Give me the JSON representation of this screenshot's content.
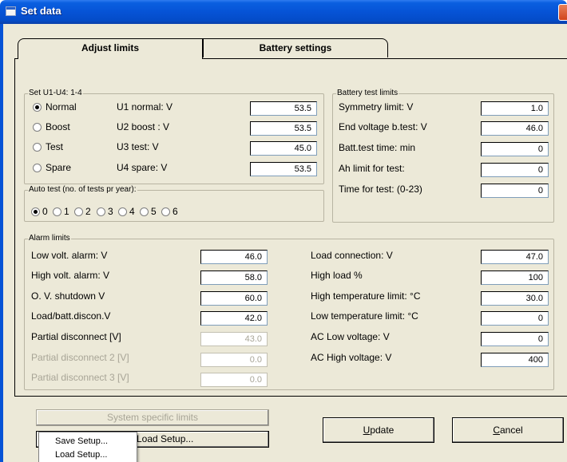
{
  "window": {
    "title": "Set data"
  },
  "tabs": [
    {
      "label": "Adjust limits",
      "active": true
    },
    {
      "label": "Battery settings",
      "active": false
    }
  ],
  "set_u": {
    "legend": "Set U1-U4: 1-4",
    "rows": [
      {
        "radio": "Normal",
        "label": "U1 normal:  V",
        "value": "53.5",
        "checked": true
      },
      {
        "radio": "Boost",
        "label": "U2 boost :  V",
        "value": "53.5",
        "checked": false
      },
      {
        "radio": "Test",
        "label": "U3 test:   V",
        "value": "45.0",
        "checked": false
      },
      {
        "radio": "Spare",
        "label": "U4 spare:   V",
        "value": "53.5",
        "checked": false
      }
    ]
  },
  "auto_test": {
    "legend": "Auto test (no. of tests pr year):",
    "options": [
      "0",
      "1",
      "2",
      "3",
      "4",
      "5",
      "6"
    ],
    "selected": "0"
  },
  "battery_test": {
    "legend": "Battery test limits",
    "rows": [
      {
        "label": "Symmetry limit: V",
        "value": "1.0"
      },
      {
        "label": "End voltage b.test: V",
        "value": "46.0"
      },
      {
        "label": "Batt.test time: min",
        "value": "0"
      },
      {
        "label": "Ah limit for test:",
        "value": "0"
      },
      {
        "label": "Time for test: (0-23)",
        "value": "0"
      }
    ]
  },
  "alarm_limits": {
    "legend": "Alarm limits",
    "left": [
      {
        "label": "Low volt. alarm: V",
        "value": "46.0",
        "disabled": false
      },
      {
        "label": "High volt. alarm: V",
        "value": "58.0",
        "disabled": false
      },
      {
        "label": "O. V. shutdown V",
        "value": "60.0",
        "disabled": false
      },
      {
        "label": "Load/batt.discon.V",
        "value": "42.0",
        "disabled": false
      },
      {
        "label": "Partial disconnect  [V]",
        "value": "43.0",
        "disabled": false,
        "value_disabled": true
      },
      {
        "label": "Partial disconnect 2 [V]",
        "value": "0.0",
        "disabled": true
      },
      {
        "label": "Partial disconnect 3 [V]",
        "value": "0.0",
        "disabled": true
      }
    ],
    "right": [
      {
        "label": "Load connection: V",
        "value": "47.0"
      },
      {
        "label": "High load %",
        "value": "100"
      },
      {
        "label": "High temperature limit: °C",
        "value": "30.0"
      },
      {
        "label": "Low temperature limit: °C",
        "value": "0"
      },
      {
        "label": "AC Low voltage: V",
        "value": "0"
      },
      {
        "label": "AC High voltage: V",
        "value": "400"
      }
    ]
  },
  "buttons": {
    "system_specific": "System specific limits",
    "load_setup": "Load Setup...",
    "update_first": "U",
    "update_rest": "pdate",
    "cancel_first": "C",
    "cancel_rest": "ancel"
  },
  "popup_menu": {
    "items": [
      "Save Setup...",
      "Load Setup..."
    ]
  }
}
